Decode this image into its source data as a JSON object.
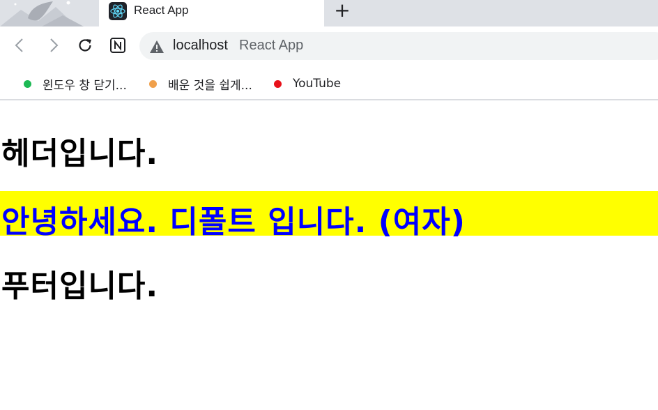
{
  "browser": {
    "tab": {
      "title": "React App",
      "favicon": "react-logo-icon"
    },
    "new_tab": "+",
    "omnibox": {
      "host": "localhost",
      "page_title": "React App",
      "security_icon": "warning-icon"
    },
    "bookmarks": [
      {
        "label": "윈도우 창 닫기...",
        "color": "#1db954"
      },
      {
        "label": "배운 것을 쉽게...",
        "color": "#f0a04b"
      },
      {
        "label": "YouTube",
        "color": "#e8111a"
      }
    ]
  },
  "page": {
    "header": "헤더입니다.",
    "banner": "안녕하세요. 디폴트 입니다. (여자)",
    "footer": "푸터입니다.",
    "banner_bg_color": "#ffff00",
    "banner_text_color": "#0000ff"
  }
}
